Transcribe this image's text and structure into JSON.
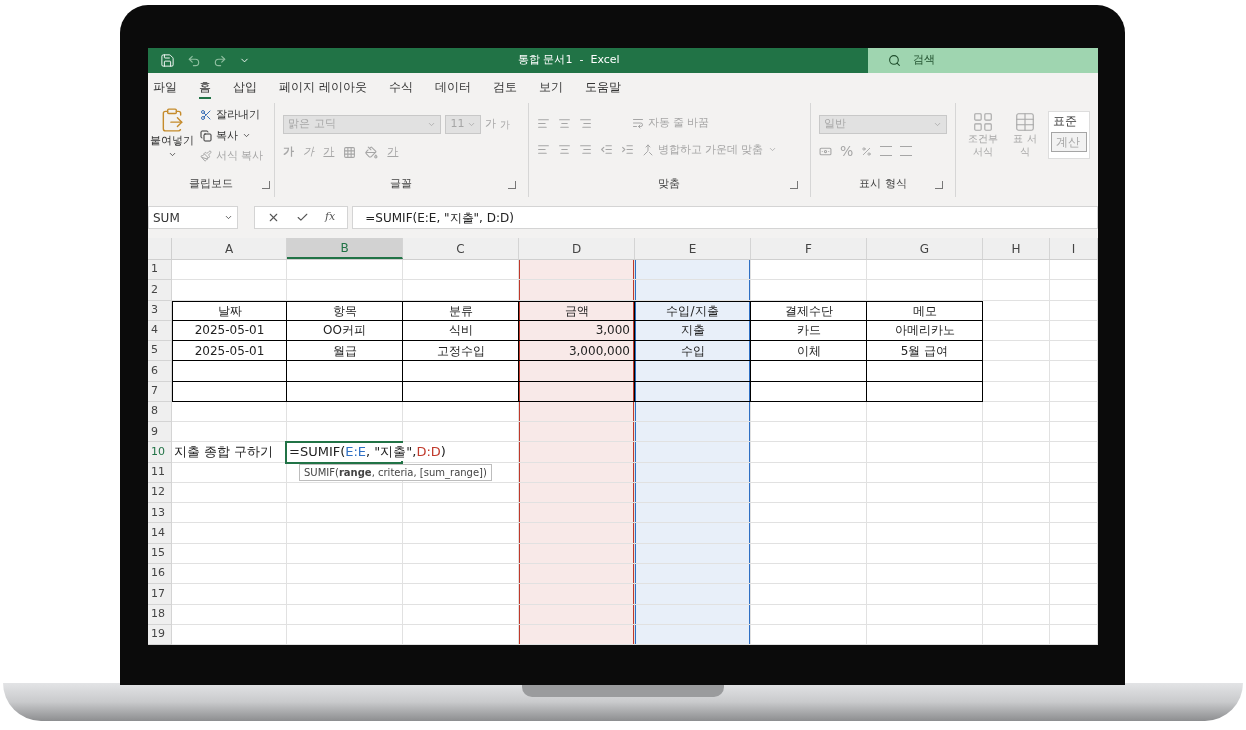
{
  "title_bar": {
    "title": "통합 문서1  -  Excel",
    "search_placeholder": "검색"
  },
  "menu_tabs": [
    {
      "label": "파일",
      "selected": false
    },
    {
      "label": "홈",
      "selected": true
    },
    {
      "label": "삽입",
      "selected": false
    },
    {
      "label": "페이지 레이아웃",
      "selected": false
    },
    {
      "label": "수식",
      "selected": false
    },
    {
      "label": "데이터",
      "selected": false
    },
    {
      "label": "검토",
      "selected": false
    },
    {
      "label": "보기",
      "selected": false
    },
    {
      "label": "도움말",
      "selected": false
    }
  ],
  "ribbon": {
    "clipboard": {
      "paste": "붙여넣기",
      "cut": "잘라내기",
      "copy": "복사",
      "format_painter": "서식 복사",
      "label": "클립보드",
      "disabled": false
    },
    "font": {
      "font_name": "맑은 고딕",
      "font_size": "11",
      "grow": "가",
      "shrink": "가",
      "bold": "가",
      "italic": "가",
      "underline": "가",
      "font_color": "가",
      "label": "글꼴",
      "disabled": true
    },
    "alignment": {
      "wrap_text": "자동 줄 바꿈",
      "merge_center": "병합하고 가운데 맞춤",
      "label": "맞춤",
      "disabled": true
    },
    "number": {
      "format": "일반",
      "percent": "%",
      "label": "표시 형식",
      "disabled": true
    },
    "styles": {
      "conditional": "조건부 서식",
      "table": "표 서식",
      "normal": "표준",
      "calculation": "계산",
      "disabled": true
    }
  },
  "formula_bar": {
    "name_box": "SUM",
    "function_label": "fx",
    "formula": "=SUMIF(E:E, \"지출\", D:D)"
  },
  "sheet": {
    "columns": [
      {
        "letter": "A",
        "selected": false
      },
      {
        "letter": "B",
        "selected": true
      },
      {
        "letter": "C",
        "selected": false
      },
      {
        "letter": "D",
        "selected": false,
        "color": "#c0392b"
      },
      {
        "letter": "E",
        "selected": false,
        "color": "#2e6fc4"
      },
      {
        "letter": "F",
        "selected": false
      },
      {
        "letter": "G",
        "selected": false
      },
      {
        "letter": "H",
        "selected": false
      },
      {
        "letter": "I",
        "selected": false
      }
    ],
    "rows": [
      {
        "number": "1",
        "selected": false,
        "bordered": false,
        "cells": []
      },
      {
        "number": "2",
        "selected": false,
        "bordered": false,
        "cells": []
      },
      {
        "number": "3",
        "selected": false,
        "bordered": true,
        "cells": [
          {
            "text": "날짜"
          },
          {
            "text": "항목"
          },
          {
            "text": "분류"
          },
          {
            "text": "금액"
          },
          {
            "text": "수입/지출"
          },
          {
            "text": "결제수단"
          },
          {
            "text": "메모"
          }
        ]
      },
      {
        "number": "4",
        "selected": false,
        "bordered": true,
        "cells": [
          {
            "text": "2025-05-01"
          },
          {
            "text": "OO커피"
          },
          {
            "text": "식비"
          },
          {
            "text": "3,000",
            "kind": "number"
          },
          {
            "text": "지출"
          },
          {
            "text": "카드"
          },
          {
            "text": "아메리카노"
          }
        ]
      },
      {
        "number": "5",
        "selected": false,
        "bordered": true,
        "cells": [
          {
            "text": "2025-05-01"
          },
          {
            "text": "월급"
          },
          {
            "text": "고정수입"
          },
          {
            "text": "3,000,000",
            "kind": "number"
          },
          {
            "text": "수입"
          },
          {
            "text": "이체"
          },
          {
            "text": "5월 급여"
          }
        ]
      },
      {
        "number": "6",
        "selected": false,
        "bordered": true,
        "cells": []
      },
      {
        "number": "7",
        "selected": false,
        "bordered": true,
        "cells": []
      },
      {
        "number": "8",
        "selected": false,
        "bordered": false,
        "cells": []
      },
      {
        "number": "9",
        "selected": false,
        "bordered": false,
        "cells": []
      },
      {
        "number": "10",
        "selected": true,
        "bordered": false,
        "cells": [
          {
            "text": "지출 종합 구하기",
            "kind": "label"
          },
          {
            "kind": "editor",
            "parts": [
              {
                "text": "=SUMIF("
              },
              {
                "text": "E:E",
                "color": "#2e6fc4"
              },
              {
                "text": ", \"지출\", "
              },
              {
                "text": "D:D",
                "color": "#c0392b"
              },
              {
                "text": ")"
              }
            ],
            "tooltip": "SUMIF(**range**, criteria, [sum_range])"
          }
        ]
      },
      {
        "number": "11",
        "selected": false,
        "bordered": false,
        "cells": []
      },
      {
        "number": "12",
        "selected": false,
        "bordered": false,
        "cells": []
      },
      {
        "number": "13",
        "selected": false,
        "bordered": false,
        "cells": []
      },
      {
        "number": "14",
        "selected": false,
        "bordered": false,
        "cells": []
      },
      {
        "number": "15",
        "selected": false,
        "bordered": false,
        "cells": []
      },
      {
        "number": "16",
        "selected": false,
        "bordered": false,
        "cells": []
      },
      {
        "number": "17",
        "selected": false,
        "bordered": false,
        "cells": []
      },
      {
        "number": "18",
        "selected": false,
        "bordered": false,
        "cells": []
      },
      {
        "number": "19",
        "selected": false,
        "bordered": false,
        "cells": []
      }
    ]
  }
}
